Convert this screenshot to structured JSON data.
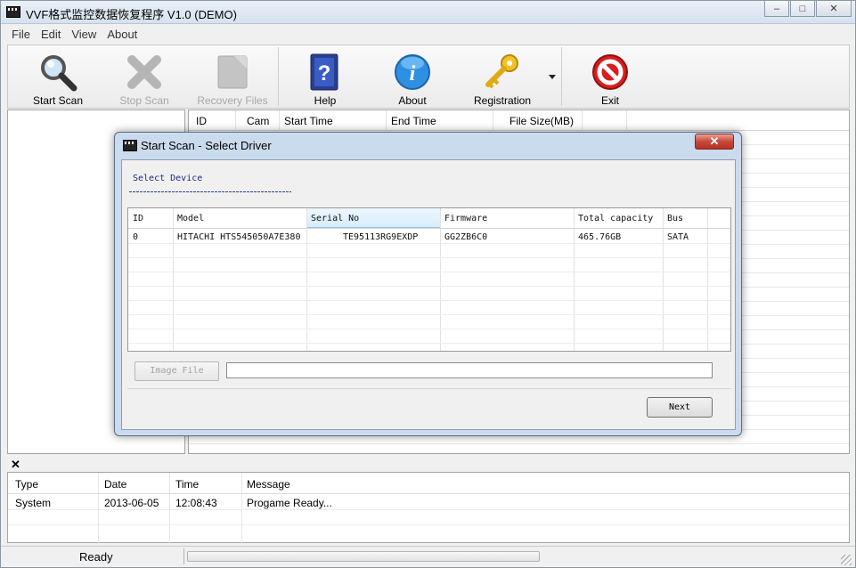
{
  "window": {
    "title": "VVF格式监控数据恢复程序 V1.0 (DEMO)",
    "minimize_glyph": "–",
    "maximize_glyph": "□",
    "close_glyph": "✕"
  },
  "menu": [
    "File",
    "Edit",
    "View",
    "About"
  ],
  "toolbar": {
    "start_scan": "Start Scan",
    "stop_scan": "Stop Scan",
    "recovery_files": "Recovery Files",
    "help": "Help",
    "about": "About",
    "registration": "Registration",
    "exit": "Exit"
  },
  "file_grid": {
    "columns": [
      "ID",
      "Cam",
      "Start Time",
      "End Time",
      "File Size(MB)"
    ]
  },
  "log": {
    "close_glyph": "✕",
    "columns": [
      "Type",
      "Date",
      "Time",
      "Message"
    ],
    "rows": [
      {
        "type": "System",
        "date": "2013-06-05",
        "time": "12:08:43",
        "message": "Progame Ready..."
      }
    ]
  },
  "status": {
    "text": "Ready",
    "progress_fraction": 0
  },
  "dialog": {
    "title": "Start Scan - Select Driver",
    "close_glyph": "✕",
    "section_label": "Select Device",
    "columns": [
      "ID",
      "Model",
      "Serial No",
      "Firmware",
      "Total capacity",
      "Bus"
    ],
    "devices": [
      {
        "id": "0",
        "model": "HITACHI HTS545050A7E380",
        "serial": "TE95113RG9EXDP",
        "firmware": "GG2ZB6C0",
        "capacity": "465.76GB",
        "bus": "SATA"
      }
    ],
    "image_file_button": "Image File",
    "image_file_value": "",
    "next_button": "Next"
  },
  "colors": {
    "accent_selected_header": "#d7ecfb",
    "progress_green": "#36c23b",
    "exit_red": "#d81e1e"
  }
}
